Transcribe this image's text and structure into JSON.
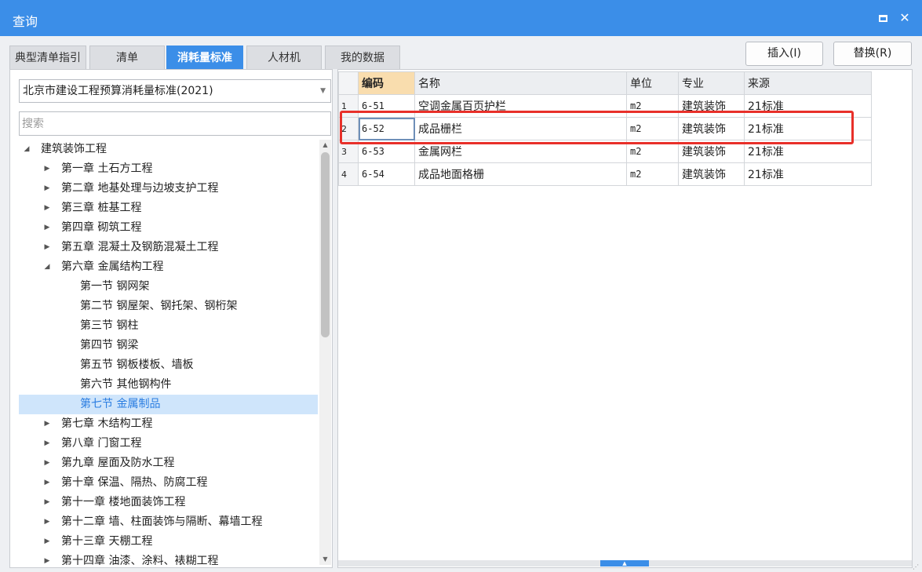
{
  "window": {
    "title": "查询"
  },
  "tabs": [
    {
      "label": "典型清单指引",
      "active": false
    },
    {
      "label": "清单",
      "active": false
    },
    {
      "label": "消耗量标准",
      "active": true
    },
    {
      "label": "人材机",
      "active": false
    },
    {
      "label": "我的数据",
      "active": false
    }
  ],
  "buttons": {
    "insert": "插入(I)",
    "replace": "替换(R)"
  },
  "left": {
    "standard_select": "北京市建设工程预算消耗量标准(2021)",
    "search_placeholder": "搜索",
    "tree": [
      {
        "label": "建筑装饰工程",
        "state": "expanded"
      },
      {
        "label": "第一章 土石方工程",
        "state": "collapsed"
      },
      {
        "label": "第二章 地基处理与边坡支护工程",
        "state": "collapsed"
      },
      {
        "label": "第三章 桩基工程",
        "state": "collapsed"
      },
      {
        "label": "第四章 砌筑工程",
        "state": "collapsed"
      },
      {
        "label": "第五章 混凝土及钢筋混凝土工程",
        "state": "collapsed"
      },
      {
        "label": "第六章 金属结构工程",
        "state": "expanded"
      },
      {
        "label": "第一节 钢网架",
        "state": "leaf"
      },
      {
        "label": "第二节 钢屋架、钢托架、钢桁架",
        "state": "leaf"
      },
      {
        "label": "第三节 钢柱",
        "state": "leaf"
      },
      {
        "label": "第四节 钢梁",
        "state": "leaf"
      },
      {
        "label": "第五节 钢板楼板、墙板",
        "state": "leaf"
      },
      {
        "label": "第六节 其他钢构件",
        "state": "leaf"
      },
      {
        "label": "第七节 金属制品",
        "state": "leaf",
        "selected": true
      },
      {
        "label": "第七章 木结构工程",
        "state": "collapsed"
      },
      {
        "label": "第八章 门窗工程",
        "state": "collapsed"
      },
      {
        "label": "第九章 屋面及防水工程",
        "state": "collapsed"
      },
      {
        "label": "第十章 保温、隔热、防腐工程",
        "state": "collapsed"
      },
      {
        "label": "第十一章 楼地面装饰工程",
        "state": "collapsed"
      },
      {
        "label": "第十二章 墙、柱面装饰与隔断、幕墙工程",
        "state": "collapsed"
      },
      {
        "label": "第十三章 天棚工程",
        "state": "collapsed"
      },
      {
        "label": "第十四章 油漆、涂料、裱糊工程",
        "state": "collapsed"
      }
    ]
  },
  "grid": {
    "columns": [
      "编码",
      "名称",
      "单位",
      "专业",
      "来源"
    ],
    "rows": [
      {
        "idx": "1",
        "code": "6-51",
        "name": "空调金属百页护栏",
        "unit": "m2",
        "major": "建筑装饰",
        "source": "21标准"
      },
      {
        "idx": "2",
        "code": "6-52",
        "name": "成品栅栏",
        "unit": "m2",
        "major": "建筑装饰",
        "source": "21标准"
      },
      {
        "idx": "3",
        "code": "6-53",
        "name": "金属网栏",
        "unit": "m2",
        "major": "建筑装饰",
        "source": "21标准"
      },
      {
        "idx": "4",
        "code": "6-54",
        "name": "成品地面格栅",
        "unit": "m2",
        "major": "建筑装饰",
        "source": "21标准"
      }
    ],
    "highlighted_row": 2
  },
  "colors": {
    "accent": "#3b8ee8",
    "highlight_border": "#e8302a",
    "selected_tree_bg": "#cfe5fb",
    "code_header_bg": "#f9ddae"
  }
}
